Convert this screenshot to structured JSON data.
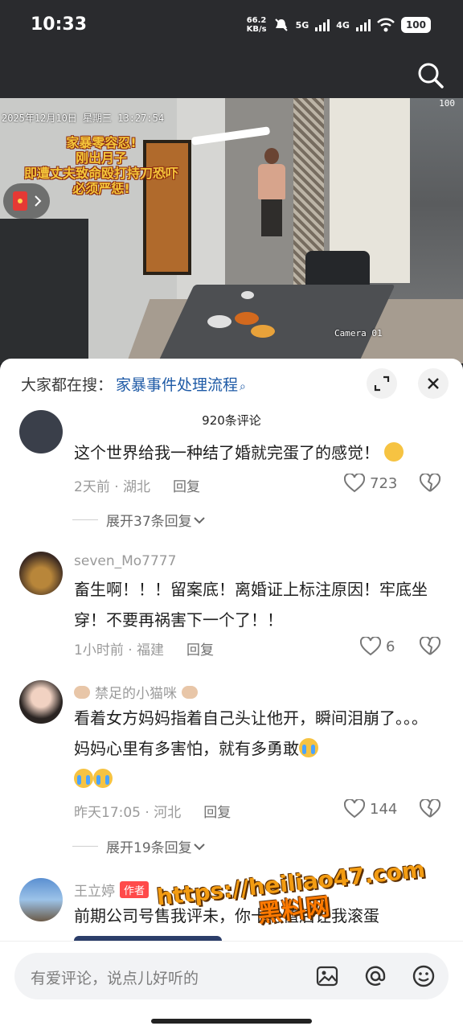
{
  "status": {
    "time": "10:33",
    "speed_top": "66.2",
    "speed_unit": "KB/s",
    "net1": "5G",
    "net2": "4G",
    "battery": "100"
  },
  "video": {
    "cctv_date": "2025年12月10日  星期三  13:27:54",
    "camera_label": "Camera 01",
    "wifi_label": "100",
    "caption_lines": [
      "家暴零容忍!",
      "刚出月子",
      "即遭丈夫致命殴打持刀恐吓",
      "必须严惩!"
    ]
  },
  "sheet": {
    "search_prefix": "大家都在搜：",
    "search_term": "家暴事件处理流程",
    "comment_count": "920条评论"
  },
  "comments": [
    {
      "text": "这个世界给我一种结了婚就完蛋了的感觉！",
      "time": "2天前",
      "location": "湖北",
      "reply": "回复",
      "likes": "723",
      "expand": "展开37条回复"
    },
    {
      "user": "seven_Mo7777",
      "text": "畜生啊！！！留案底！离婚证上标注原因！牢底坐穿！不要再祸害下一个了！！",
      "time": "1小时前",
      "location": "福建",
      "reply": "回复",
      "likes": "6"
    },
    {
      "user": "禁足的小猫咪",
      "text": "看着女方妈妈指着自己头让他开，瞬间泪崩了。。。妈妈心里有多害怕，就有多勇敢",
      "time": "昨天17:05",
      "location": "河北",
      "reply": "回复",
      "likes": "144",
      "expand": "展开19条回复"
    },
    {
      "user": "王立婷",
      "badge": "作者",
      "text": "前期公司号售我评未，你十份值后让我滚蛋"
    }
  ],
  "watermark": {
    "url": "https://heiliao47.com",
    "name": "黑料网"
  },
  "input": {
    "placeholder": "有爱评论，说点儿好听的"
  },
  "icons": [
    "search-icon",
    "expand-icon",
    "close-icon",
    "heart-icon",
    "broken-heart-icon",
    "chevron-down-icon",
    "image-icon",
    "at-icon",
    "emoji-icon",
    "red-packet-icon"
  ]
}
